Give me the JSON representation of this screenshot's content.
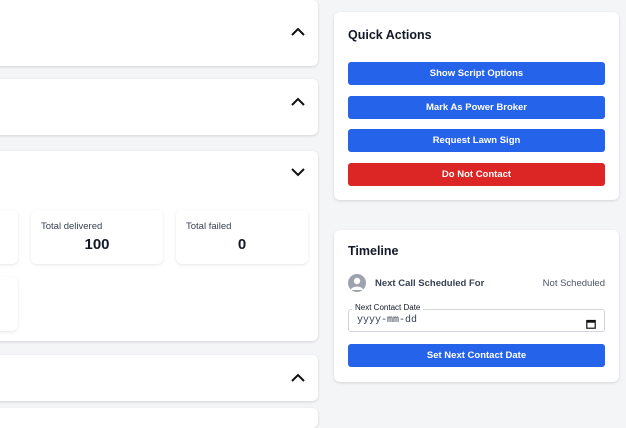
{
  "stats": {
    "total_delivered_label": "Total delivered",
    "total_delivered_value": "100",
    "total_failed_label": "Total failed",
    "total_failed_value": "0"
  },
  "quick_actions": {
    "title": "Quick Actions",
    "buttons": [
      {
        "label": "Show Script Options",
        "color": "#2563eb"
      },
      {
        "label": "Mark As Power Broker",
        "color": "#2563eb"
      },
      {
        "label": "Request Lawn Sign",
        "color": "#2563eb"
      },
      {
        "label": "Do Not Contact",
        "color": "#dc2626"
      }
    ]
  },
  "timeline": {
    "title": "Timeline",
    "next_call_label": "Next Call Scheduled For",
    "next_call_value": "Not Scheduled",
    "next_contact_date_label": "Next Contact Date",
    "next_contact_date_placeholder": "yyyy-mm-dd",
    "set_button_label": "Set Next Contact Date"
  },
  "icons": [
    "chevron-up-icon",
    "chevron-down-icon",
    "user-icon",
    "calendar-icon"
  ]
}
